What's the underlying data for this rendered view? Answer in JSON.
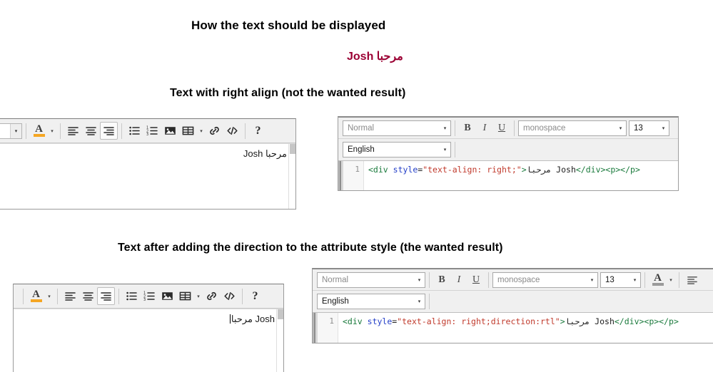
{
  "headings": {
    "main": "How the text should be displayed",
    "section_right_align": "Text with right align (not the wanted result)",
    "section_direction": "Text after adding the direction to the attribute style (the wanted result)"
  },
  "sample": {
    "text": "مرحبا Josh",
    "color": "#9b0033"
  },
  "editor_top": {
    "toolbar": {
      "style_select_value": "",
      "font_color_label": "A",
      "buttons": [
        "align-left",
        "align-center",
        "align-right",
        "bullet-list",
        "numbered-list",
        "image",
        "table",
        "link",
        "code",
        "help"
      ],
      "active_button": "align-right",
      "help_label": "?"
    },
    "content": "Josh مرحبا"
  },
  "editor_bottom": {
    "toolbar": {
      "font_color_label": "A",
      "buttons": [
        "align-left",
        "align-center",
        "align-right",
        "bullet-list",
        "numbered-list",
        "image",
        "table",
        "link",
        "code",
        "help"
      ],
      "active_button": "align-right",
      "help_label": "?"
    },
    "content": "Josh مرحبا"
  },
  "code_top": {
    "toolbar": {
      "block_format": "Normal",
      "bold": "B",
      "italic": "I",
      "underline": "U",
      "font_family": "monospace",
      "font_size": "13",
      "language": "English"
    },
    "line_number": "1",
    "code": {
      "tag_open": "<div",
      "attr": "style",
      "eq": "=",
      "value": "\"text-align: right;\"",
      "gt": ">",
      "arabic": "مرحبا",
      "name": " Josh",
      "tag_close": "</div><p></p>"
    }
  },
  "code_bottom": {
    "toolbar": {
      "block_format": "Normal",
      "bold": "B",
      "italic": "I",
      "underline": "U",
      "font_family": "monospace",
      "font_size": "13",
      "font_color_label": "A",
      "language": "English"
    },
    "line_number": "1",
    "code": {
      "tag_open": "<div",
      "attr": "style",
      "eq": "=",
      "value": "\"text-align: right;direction:rtl\"",
      "gt": ">",
      "arabic": "مرحبا",
      "name": " Josh",
      "tag_close": "</div><p></p>"
    }
  }
}
